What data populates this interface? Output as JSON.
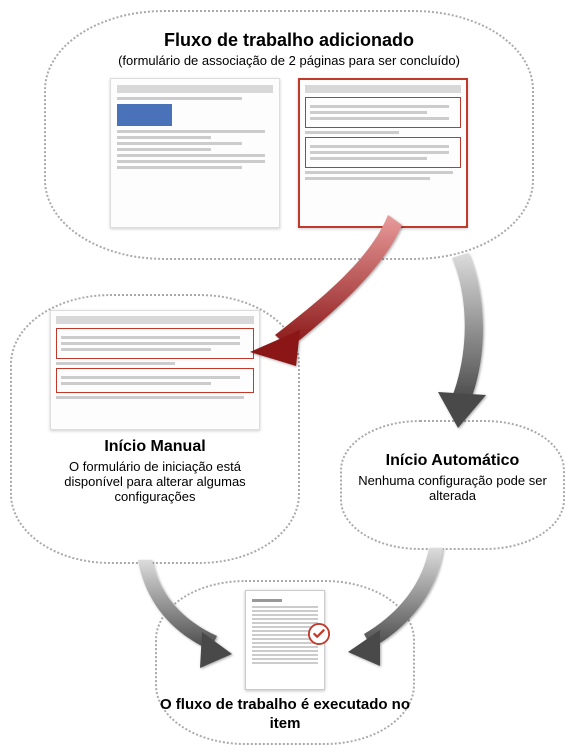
{
  "top": {
    "title": "Fluxo de trabalho adicionado",
    "subtitle": "(formulário de associação de 2 páginas para ser concluído)"
  },
  "left": {
    "title": "Início Manual",
    "desc": "O formulário de iniciação está disponível para alterar algumas configurações"
  },
  "right": {
    "title": "Início Automático",
    "desc": "Nenhuma configuração pode ser alterada"
  },
  "bottom": {
    "title": "O fluxo de trabalho é executado no item"
  },
  "icons": {
    "check": "check-circle-icon"
  },
  "colors": {
    "red_arrow": "#b02121",
    "gray_arrow_light": "#cfcfcf",
    "gray_arrow_dark": "#555555",
    "border_dotted": "#aaaaaa"
  }
}
